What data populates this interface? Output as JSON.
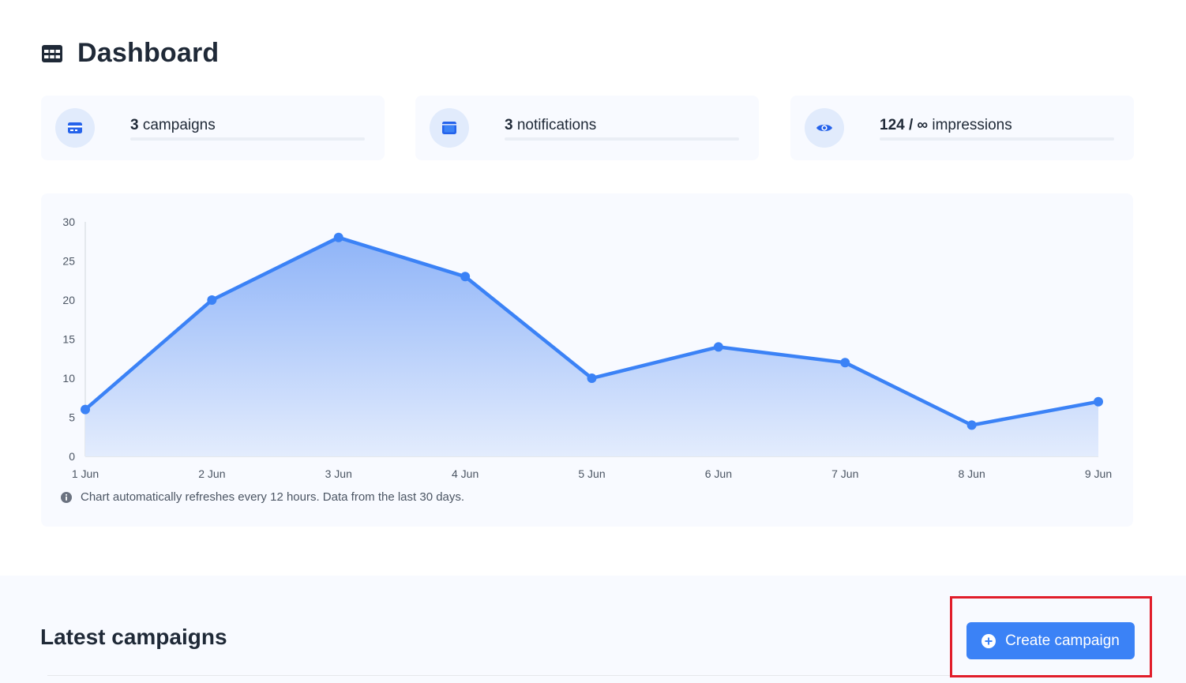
{
  "header": {
    "title": "Dashboard",
    "icon": "table-grid-icon"
  },
  "stats": [
    {
      "icon": "credit-card-icon",
      "count": "3",
      "label": "campaigns"
    },
    {
      "icon": "window-icon",
      "count": "3",
      "label": "notifications"
    },
    {
      "icon": "eye-icon",
      "count": "124 / ∞",
      "label": "impressions"
    }
  ],
  "chart_data": {
    "type": "area",
    "x": [
      "1 Jun",
      "2 Jun",
      "3 Jun",
      "4 Jun",
      "5 Jun",
      "6 Jun",
      "7 Jun",
      "8 Jun",
      "9 Jun"
    ],
    "series": [
      {
        "values": [
          6,
          20,
          28,
          23,
          10,
          14,
          12,
          4,
          7
        ]
      }
    ],
    "ylim": [
      0,
      30
    ],
    "yticks": [
      0,
      5,
      10,
      15,
      20,
      25,
      30
    ],
    "grid": false,
    "colors": {
      "line": "#3b82f6",
      "fill_top": "#8fb4f8",
      "fill_bottom": "#e3ecfd"
    }
  },
  "chart_note": "Chart automatically refreshes every 12 hours. Data from the last 30 days.",
  "latest": {
    "title": "Latest campaigns",
    "create_button": "Create campaign"
  },
  "colors": {
    "accent": "#3b82f6",
    "highlight": "#e11d2a"
  }
}
